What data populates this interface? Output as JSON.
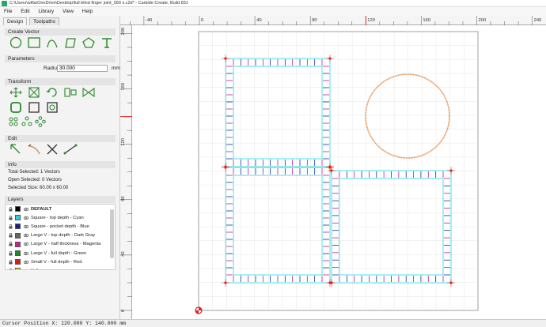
{
  "window": {
    "title": "C:\\Users\\willa\\OneDrive\\Desktop\\full blind finger joint_090 x.c2d* - Carbide Create, Build 831"
  },
  "menu": [
    "File",
    "Edit",
    "Library",
    "View",
    "Help"
  ],
  "tabs": [
    "Design",
    "Toolpaths"
  ],
  "panels": {
    "create_vector": "Create Vector",
    "parameters": "Parameters",
    "transform": "Transform",
    "edit": "Edit",
    "info": "Info",
    "layers": "Layers"
  },
  "params": {
    "radius_label": "Radius",
    "radius_value": "30.000",
    "unit": "mm"
  },
  "info": {
    "total_selected": "Total Selected:   1 Vectors",
    "open_selected": "Open Selected:   0 Vectors",
    "selected_size": "Selected Size:    60.00 x 60.00"
  },
  "layers": [
    {
      "name": "DEFAULT",
      "color": "#000000",
      "bold": true
    },
    {
      "name": "Square - top depth - Cyan",
      "color": "#22d3e0"
    },
    {
      "name": "Square - pocket depth - Blue",
      "color": "#1a1a8a"
    },
    {
      "name": "Large V - top depth - Dark Gray",
      "color": "#666666"
    },
    {
      "name": "Large V - half thickness - Magenta",
      "color": "#d11aa0"
    },
    {
      "name": "Large V - full depth - Green",
      "color": "#1a8a2a"
    },
    {
      "name": "Small V - full depth - Red",
      "color": "#e01a1a"
    },
    {
      "name": "Yellow",
      "color": "#e0d000"
    }
  ],
  "ruler": {
    "x_ticks": [
      "-40",
      "0",
      "40",
      "80",
      "120",
      "160",
      "200",
      "240"
    ],
    "y_ticks": [
      "200",
      "160",
      "120",
      "80",
      "40",
      "0"
    ]
  },
  "status": {
    "cursor": "Cursor Position X: 120.000 Y: 140.000 mm"
  },
  "colors": {
    "cyan": "#20d8e6",
    "magenta": "#c8189c",
    "blue": "#2030a0",
    "red": "#e02020",
    "circle": "#e6965a",
    "grid": "#e6e6e6"
  }
}
